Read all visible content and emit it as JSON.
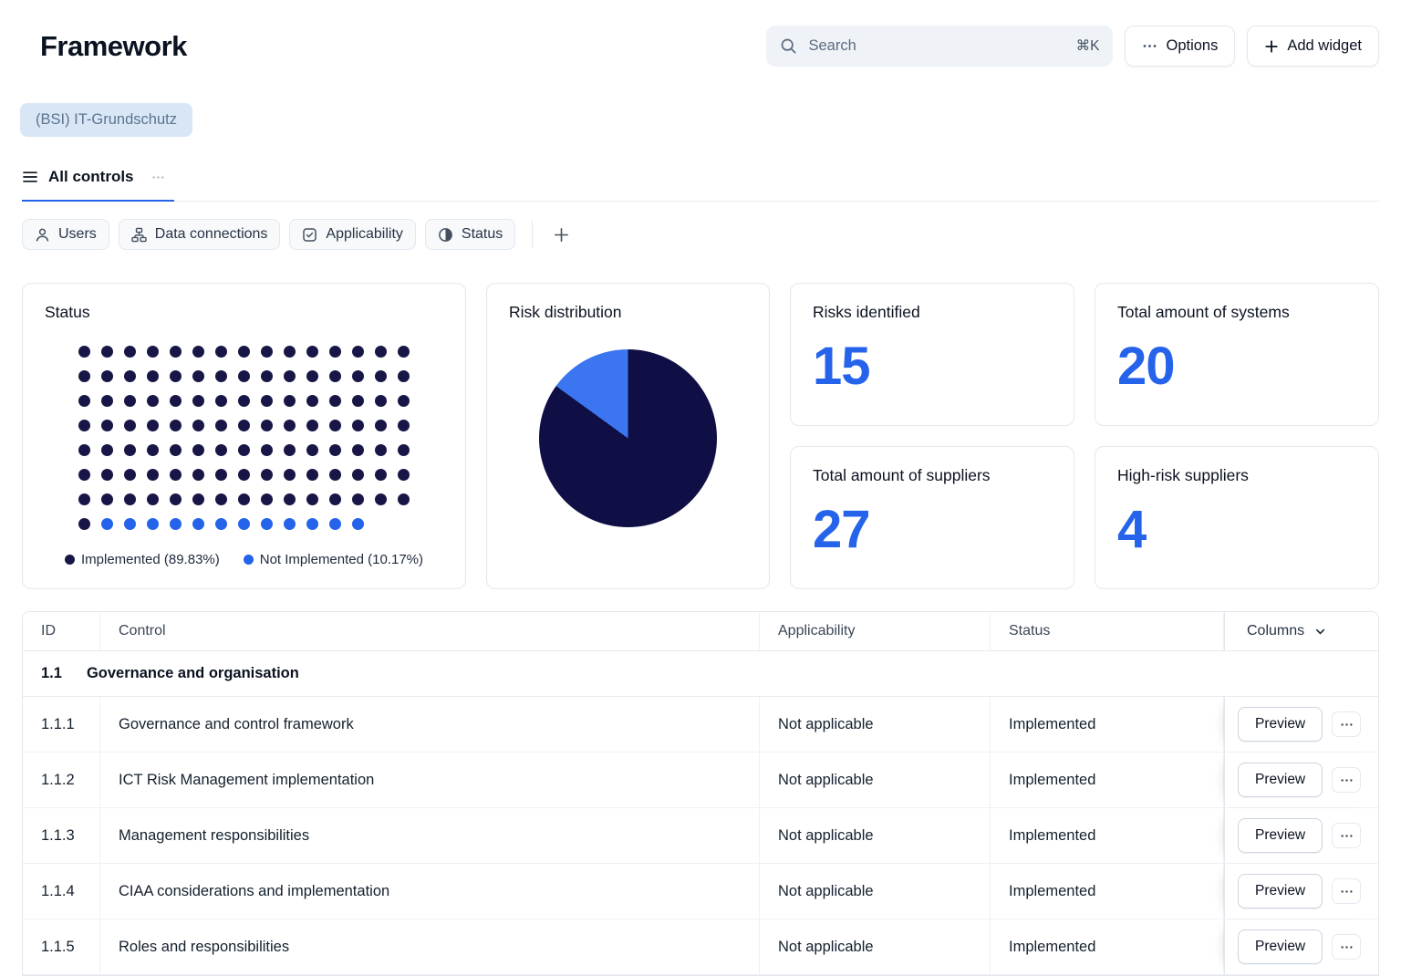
{
  "header": {
    "title": "Framework",
    "search": {
      "placeholder": "Search",
      "shortcut": "⌘K"
    },
    "options_label": "Options",
    "add_widget_label": "Add widget"
  },
  "framework_chip": "(BSI) IT-Grundschutz",
  "tabs": [
    {
      "label": "All controls"
    }
  ],
  "filters": [
    {
      "label": "Users",
      "icon": "user-icon"
    },
    {
      "label": "Data connections",
      "icon": "hierarchy-icon"
    },
    {
      "label": "Applicability",
      "icon": "checkbox-icon"
    },
    {
      "label": "Status",
      "icon": "contrast-icon"
    }
  ],
  "chart_data": [
    {
      "type": "waffle",
      "title": "Status",
      "columns": 15,
      "total_dots": 118,
      "series": [
        {
          "name": "Implemented",
          "percent": 89.83,
          "dots": 106,
          "color": "#181646",
          "legend_label": "Implemented (89.83%)"
        },
        {
          "name": "Not Implemented",
          "percent": 10.17,
          "dots": 12,
          "color": "#2563eb",
          "legend_label": "Not Implemented (10.17%)"
        }
      ]
    },
    {
      "type": "pie",
      "title": "Risk distribution",
      "slices": [
        {
          "value": 85,
          "color": "#100f45"
        },
        {
          "value": 15,
          "color": "#3b76f0"
        }
      ]
    }
  ],
  "cards": {
    "stats": [
      {
        "title": "Risks identified",
        "value": "15"
      },
      {
        "title": "Total amount of systems",
        "value": "20"
      },
      {
        "title": "Total amount of suppliers",
        "value": "27"
      },
      {
        "title": "High-risk suppliers",
        "value": "4"
      }
    ]
  },
  "table": {
    "columns": [
      "ID",
      "Control",
      "Applicability",
      "Status"
    ],
    "columns_menu_label": "Columns",
    "section": {
      "id": "1.1",
      "title": "Governance and organisation"
    },
    "row_action_label": "Preview",
    "rows": [
      {
        "id": "1.1.1",
        "control": "Governance and control framework",
        "applicability": "Not applicable",
        "status": "Implemented"
      },
      {
        "id": "1.1.2",
        "control": "ICT Risk Management implementation",
        "applicability": "Not applicable",
        "status": "Implemented"
      },
      {
        "id": "1.1.3",
        "control": "Management responsibilities",
        "applicability": "Not applicable",
        "status": "Implemented"
      },
      {
        "id": "1.1.4",
        "control": "CIAA considerations and implementation",
        "applicability": "Not applicable",
        "status": "Implemented"
      },
      {
        "id": "1.1.5",
        "control": "Roles and responsibilities",
        "applicability": "Not applicable",
        "status": "Implemented"
      }
    ]
  },
  "colors": {
    "accent": "#2563eb",
    "dark_navy": "#181646",
    "chip_bg": "#d9e6f6"
  }
}
